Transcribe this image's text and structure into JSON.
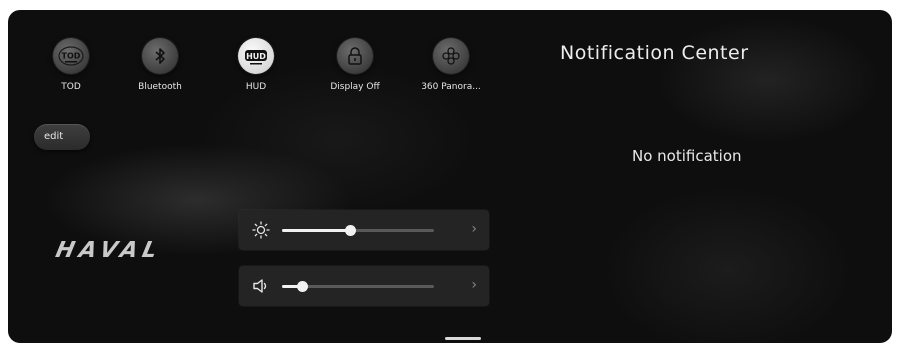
{
  "quick_settings": [
    {
      "label": "TOD",
      "icon": "tod-icon",
      "icon_text": "TOD"
    },
    {
      "label": "Bluetooth",
      "icon": "bluetooth-icon"
    },
    {
      "label": "HUD",
      "icon": "hud-icon",
      "icon_text": "HUD"
    },
    {
      "label": "Display Off",
      "icon": "lock-icon"
    },
    {
      "label": "360 Panora...",
      "icon": "panorama-icon"
    }
  ],
  "edit_label": "edit",
  "logo_text": "HAVAL",
  "brightness": {
    "icon": "sun-icon",
    "level": 0.45
  },
  "volume": {
    "icon": "speaker-icon",
    "level": 0.13
  },
  "notification_center": {
    "title": "Notification Center",
    "empty_text": "No notification"
  },
  "colors": {
    "background": "#0e0e0e",
    "card": "#242424",
    "text": "#ededed"
  }
}
